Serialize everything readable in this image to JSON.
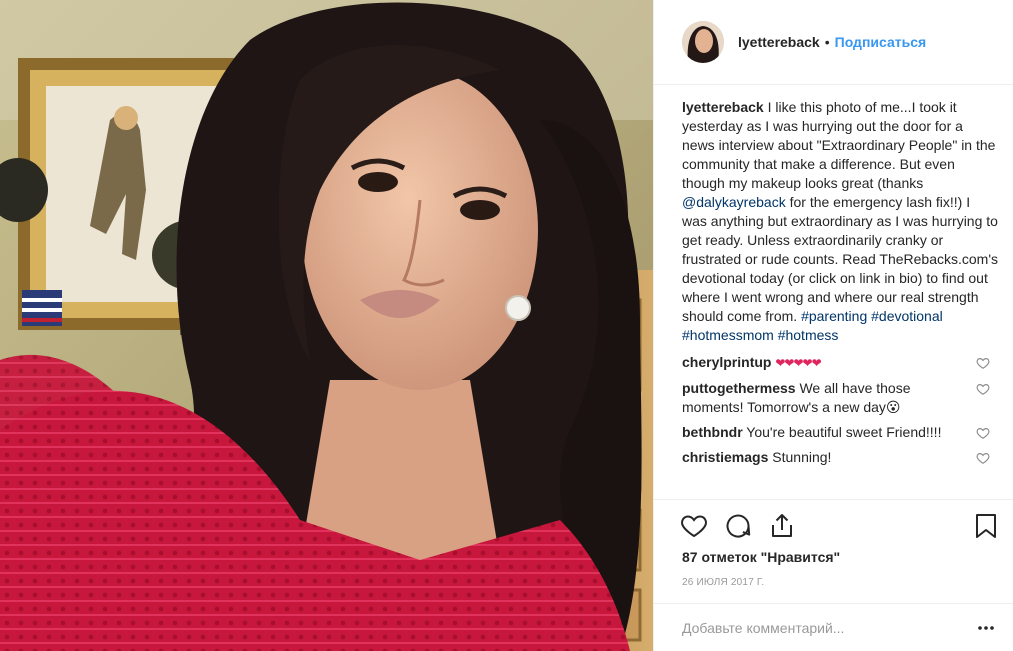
{
  "photo": {
    "alt_colors": {
      "dress": "#c7163a",
      "hair": "#1e1514",
      "wall": "#b9aa7e"
    }
  },
  "header": {
    "username": "lyettereback",
    "separator": "•",
    "follow_label": "Подписаться"
  },
  "caption": {
    "author": "lyettereback",
    "text_1": " I like this photo of me...I took it yesterday as I was hurrying out the door for a news interview about \"Extraordinary People\" in the community that make a difference. But even though my makeup looks great (thanks ",
    "mention": "@dalykayreback",
    "text_2": " for the emergency lash fix!!) I was anything but extraordinary as I was hurrying to get ready. Unless extraordinarily cranky or frustrated or rude counts. Read TheRebacks.com's devotional today (or click on link in bio) to find out where I went wrong and where our real strength should come from. ",
    "tags": [
      "#parenting",
      "#devotional",
      "#hotmessmom",
      "#hotmess"
    ]
  },
  "comments": [
    {
      "author": "cherylprintup",
      "text": " ",
      "hearts": "❤❤❤❤❤"
    },
    {
      "author": "puttogethermess",
      "text": " We all have those moments! Tomorrow's a new day😮"
    },
    {
      "author": "bethbndr",
      "text": " You're beautiful sweet Friend!!!!"
    },
    {
      "author": "christiemags",
      "text": " Stunning!"
    }
  ],
  "actions": {
    "icons": [
      "heart-outline-icon",
      "comment-bubble-icon",
      "share-icon",
      "bookmark-icon"
    ]
  },
  "likes_label": "87 отметок \"Нравится\"",
  "date": "26 ИЮЛЯ 2017 Г.",
  "add_comment": {
    "placeholder": "Добавьте комментарий..."
  },
  "colors": {
    "link": "#3897f0",
    "mention": "#003569",
    "text": "#262626",
    "muted": "#999999",
    "border": "#efefef"
  }
}
